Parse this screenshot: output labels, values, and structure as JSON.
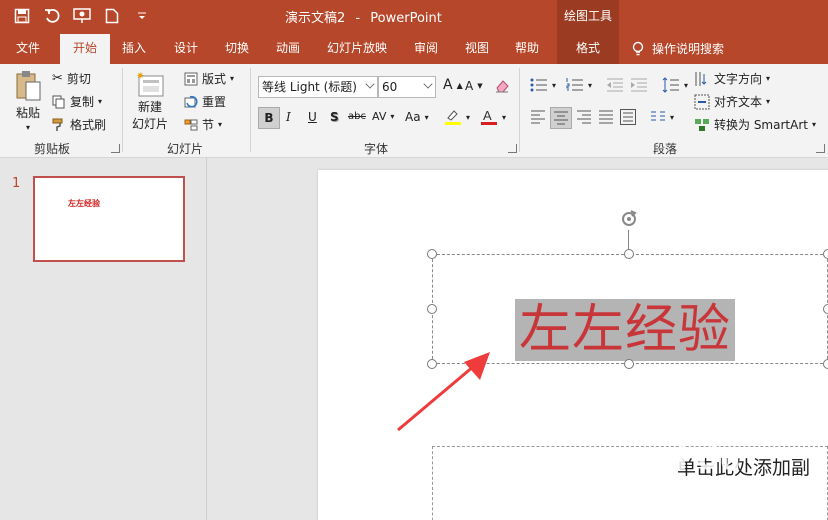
{
  "app": {
    "document_name": "演示文稿2",
    "separator": "-",
    "product": "PowerPoint",
    "contextual_group": "绘图工具"
  },
  "tabs": [
    "文件",
    "开始",
    "插入",
    "设计",
    "切换",
    "动画",
    "幻灯片放映",
    "审阅",
    "视图",
    "帮助",
    "格式"
  ],
  "active_tab": "开始",
  "tell_me": "操作说明搜索",
  "ribbon": {
    "clipboard": {
      "paste": "粘贴",
      "cut": "剪切",
      "copy": "复制",
      "format_painter": "格式刷",
      "label": "剪贴板"
    },
    "slides": {
      "new_slide_line1": "新建",
      "new_slide_line2": "幻灯片",
      "layout": "版式",
      "reset": "重置",
      "section": "节",
      "label": "幻灯片"
    },
    "font": {
      "font_name": "等线 Light (标题)",
      "font_size": "60",
      "grow": "A",
      "shrink": "A",
      "bold": "B",
      "italic": "I",
      "underline": "U",
      "shadow": "S",
      "strike": "abc",
      "spacing": "AV",
      "case": "Aa",
      "label": "字体"
    },
    "paragraph": {
      "text_direction": "文字方向",
      "align_text": "对齐文本",
      "smartart": "转换为 SmartArt",
      "label": "段落"
    }
  },
  "thumbnails": [
    {
      "number": "1",
      "title": "左左经验"
    }
  ],
  "slide": {
    "title": "左左经验",
    "subtitle_placeholder": "单击此处添加副"
  },
  "watermark": {
    "brand": "Bai du",
    "url": "jingyan.baidu.com"
  },
  "colors": {
    "accent": "#b7472a",
    "title_text": "#c8363a",
    "selection": "#b4b4b4"
  }
}
